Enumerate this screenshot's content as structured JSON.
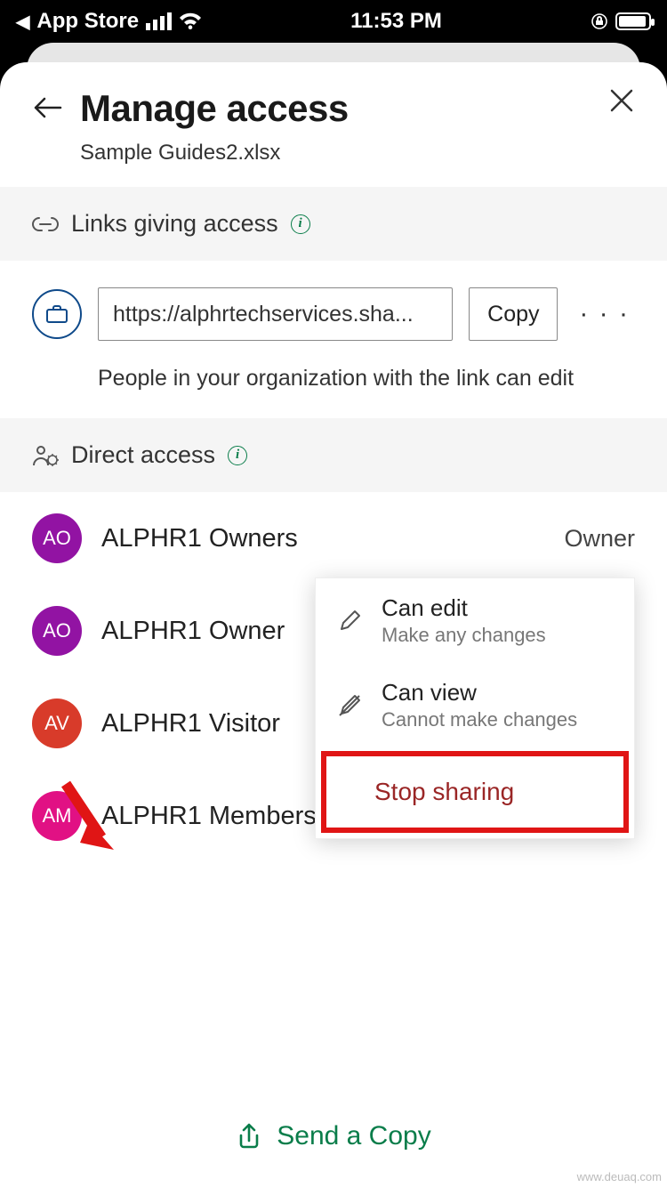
{
  "status_bar": {
    "back_label": "App Store",
    "time": "11:53 PM"
  },
  "header": {
    "title": "Manage access",
    "subtitle": "Sample Guides2.xlsx"
  },
  "sections": {
    "links_label": "Links giving access",
    "direct_label": "Direct access"
  },
  "link": {
    "url_display": "https://alphrtechservices.sha...",
    "copy_label": "Copy",
    "description": "People in your organization with the link can edit"
  },
  "members": [
    {
      "initials": "AO",
      "name": "ALPHR1 Owners",
      "role": "Owner",
      "color": "#9213a3"
    },
    {
      "initials": "AO",
      "name": "ALPHR1 Owner",
      "role": "",
      "color": "#9213a3"
    },
    {
      "initials": "AV",
      "name": "ALPHR1 Visitor",
      "role": "",
      "color": "#d83b2a"
    },
    {
      "initials": "AM",
      "name": "ALPHR1 Members",
      "role": "",
      "color": "#e11184"
    }
  ],
  "popup": {
    "options": [
      {
        "title": "Can edit",
        "subtitle": "Make any changes"
      },
      {
        "title": "Can view",
        "subtitle": "Cannot make changes"
      }
    ],
    "stop_label": "Stop sharing"
  },
  "footer": {
    "send_copy": "Send a Copy"
  },
  "watermark": "www.deuaq.com"
}
